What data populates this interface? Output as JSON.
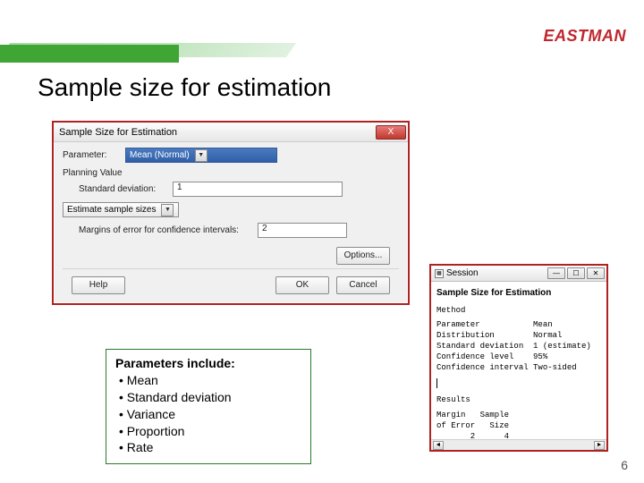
{
  "brand": "EASTMAN",
  "slide_title": "Sample size for estimation",
  "page_number": "6",
  "dialog": {
    "title": "Sample Size for Estimation",
    "close": "X",
    "parameter_label": "Parameter:",
    "parameter_value": "Mean (Normal)",
    "planning_value_label": "Planning Value",
    "std_dev_label": "Standard deviation:",
    "std_dev_value": "1",
    "estimate_value": "Estimate sample sizes",
    "margins_label": "Margins of error for confidence intervals:",
    "margins_value": "2",
    "options_btn": "Options...",
    "help_btn": "Help",
    "ok_btn": "OK",
    "cancel_btn": "Cancel"
  },
  "param_box": {
    "header": "Parameters include:",
    "items": [
      "Mean",
      "Standard deviation",
      "Variance",
      "Proportion",
      "Rate"
    ]
  },
  "session": {
    "title": "Session",
    "heading": "Sample Size for Estimation",
    "method_label": "Method",
    "method_lines": "Parameter           Mean\nDistribution        Normal\nStandard deviation  1 (estimate)\nConfidence level    95%\nConfidence interval Two-sided",
    "results_label": "Results",
    "results_lines": "Margin   Sample\nof Error   Size\n       2      4"
  }
}
